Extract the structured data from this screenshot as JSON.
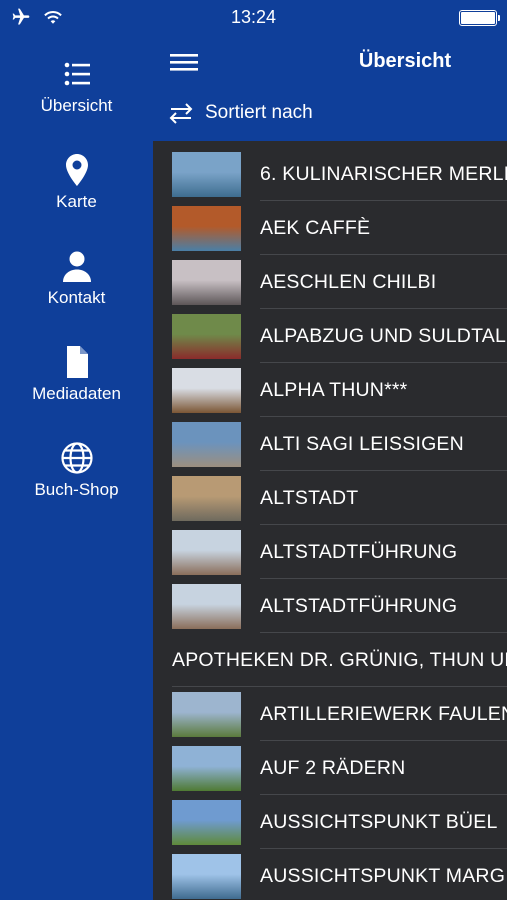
{
  "status": {
    "time": "13:24",
    "icons": [
      "airplane-icon",
      "wifi-icon",
      "battery-icon"
    ]
  },
  "sidebar": {
    "items": [
      {
        "label": "Übersicht",
        "icon": "list-icon"
      },
      {
        "label": "Karte",
        "icon": "map-pin-icon"
      },
      {
        "label": "Kontakt",
        "icon": "person-icon"
      },
      {
        "label": "Mediadaten",
        "icon": "document-icon"
      },
      {
        "label": "Buch-Shop",
        "icon": "globe-icon"
      }
    ]
  },
  "header": {
    "title": "Übersicht",
    "sort_label": "Sortiert nach"
  },
  "list": {
    "rows": [
      {
        "title": "6. KULINARISCHER MERLI",
        "has_image": true,
        "thumb_top": "#7aa3c8",
        "thumb_bottom": "#3e6d8f"
      },
      {
        "title": "AEK CAFFÈ",
        "has_image": true,
        "thumb_top": "#b35a2a",
        "thumb_bottom": "#4a7fa6"
      },
      {
        "title": "AESCHLEN CHILBI",
        "has_image": true,
        "thumb_top": "#c8c0c4",
        "thumb_bottom": "#5d5658"
      },
      {
        "title": "ALPABZUG UND SULDTAL",
        "has_image": true,
        "thumb_top": "#6f8a4a",
        "thumb_bottom": "#8a2b2b"
      },
      {
        "title": "ALPHA THUN***",
        "has_image": true,
        "thumb_top": "#d9dde4",
        "thumb_bottom": "#7b5634"
      },
      {
        "title": "ALTI SAGI LEISSIGEN",
        "has_image": true,
        "thumb_top": "#6b93bd",
        "thumb_bottom": "#9c8f7f"
      },
      {
        "title": "ALTSTADT",
        "has_image": true,
        "thumb_top": "#b89a74",
        "thumb_bottom": "#6e6a5e"
      },
      {
        "title": "ALTSTADTFÜHRUNG",
        "has_image": true,
        "thumb_top": "#c7d3e0",
        "thumb_bottom": "#8a6e5a"
      },
      {
        "title": "ALTSTADTFÜHRUNG",
        "has_image": true,
        "thumb_top": "#c7d3e0",
        "thumb_bottom": "#8a6e5a"
      },
      {
        "title": "APOTHEKEN DR. GRÜNIG, THUN UN",
        "has_image": false
      },
      {
        "title": "ARTILLERIEWERK FAULEN",
        "has_image": true,
        "thumb_top": "#9db5cf",
        "thumb_bottom": "#5b7a3c"
      },
      {
        "title": "AUF 2 RÄDERN",
        "has_image": true,
        "thumb_top": "#8fb2d6",
        "thumb_bottom": "#4f7a33"
      },
      {
        "title": "AUSSICHTSPUNKT BÜEL",
        "has_image": true,
        "thumb_top": "#6f9bd0",
        "thumb_bottom": "#5f8a3a"
      },
      {
        "title": "AUSSICHTSPUNKT MARG",
        "has_image": true,
        "thumb_top": "#9fc3e8",
        "thumb_bottom": "#3f6b8f"
      }
    ]
  },
  "colors": {
    "primary": "#0f3f9a",
    "list_bg": "#2a2b2e",
    "divider": "#45474b",
    "text": "#ffffff"
  }
}
